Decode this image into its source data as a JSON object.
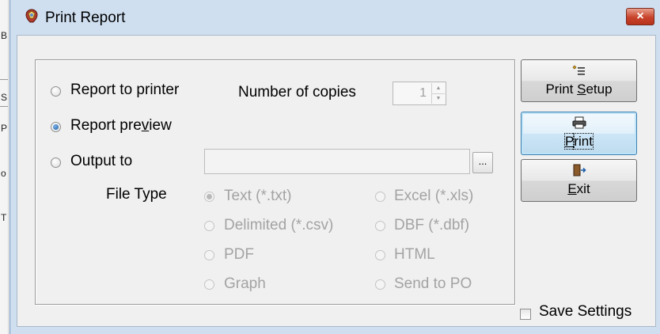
{
  "background_app": {
    "letters": [
      "B",
      "S",
      "P",
      "o",
      "T"
    ]
  },
  "window": {
    "title": "Print Report",
    "close_glyph": "×"
  },
  "output_options": {
    "report_to_printer": "Report to printer",
    "report_preview": "Report preview",
    "output_to": "Output to",
    "selected": "report_preview"
  },
  "copies": {
    "label": "Number of copies",
    "value": "1",
    "up_glyph": "▲",
    "down_glyph": "▼"
  },
  "output_path": {
    "value": "",
    "browse_label": "..."
  },
  "file_type": {
    "label": "File Type",
    "options": {
      "text": "Text (*.txt)",
      "excel": "Excel (*.xls)",
      "delimited": "Delimited (*.csv)",
      "dbf": "DBF (*.dbf)",
      "pdf": "PDF",
      "html": "HTML",
      "graph": "Graph",
      "send_to_po": "Send to PO"
    },
    "selected": "text",
    "enabled": false
  },
  "buttons": {
    "print_setup": {
      "pre": "Print ",
      "mnemonic": "S",
      "post": "etup",
      "icon": "print-setup-icon"
    },
    "print": {
      "pre": "",
      "mnemonic": "P",
      "post": "rint",
      "icon": "printer-icon"
    },
    "exit": {
      "pre": "",
      "mnemonic": "E",
      "post": "xit",
      "icon": "exit-door-icon"
    }
  },
  "save_settings": {
    "label": "Save Settings",
    "checked": false
  },
  "colors": {
    "titlebar": "#cfdff0",
    "dialog_face": "#f0f0f0",
    "close_button": "#c8432b",
    "radio_selected": "#1d5fa8",
    "disabled_text": "#a3a3a3"
  }
}
